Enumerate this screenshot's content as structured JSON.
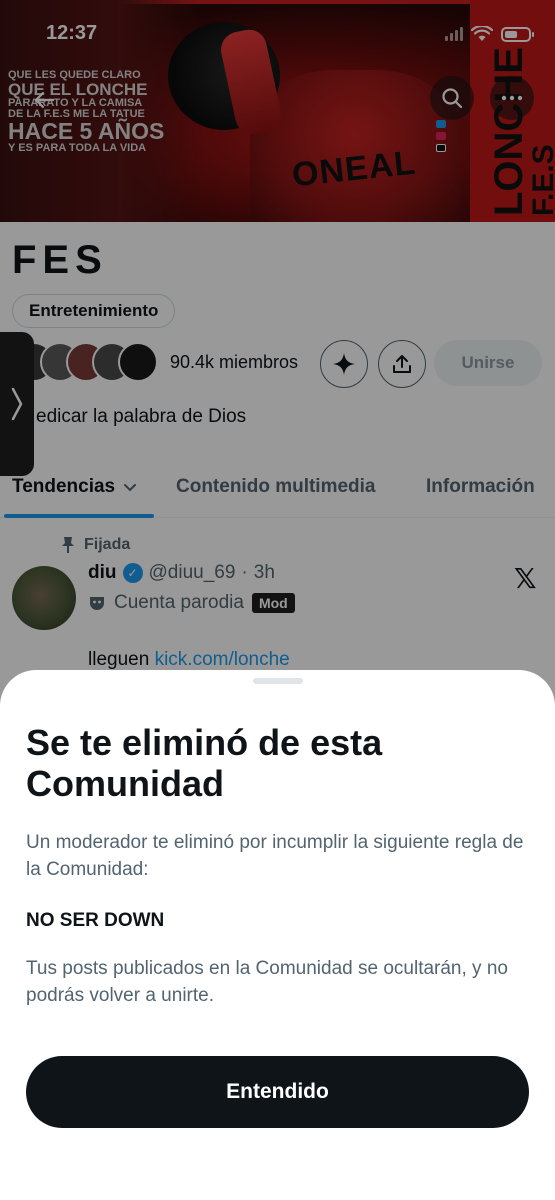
{
  "status_bar": {
    "time": "12:37"
  },
  "banner": {
    "quote_lines": [
      "QUE LES QUEDE CLARO",
      "QUE EL LONCHE",
      "PARARATO Y LA CAMISA",
      "DE LA F.E.S ME LA TATUE",
      "HACE 5 AÑOS",
      "Y ES PARA TODA LA VIDA"
    ],
    "brand": "ONEAL",
    "vertical_big": "LONCHE",
    "vertical_small": "F.E.S"
  },
  "community": {
    "name": "FES",
    "category": "Entretenimiento",
    "members": "90.4k miembros",
    "join_label": "Unirse",
    "description": "edicar la palabra de Dios"
  },
  "tabs": [
    {
      "label": "Tendencias",
      "active": true
    },
    {
      "label": "Contenido multimedia",
      "active": false
    },
    {
      "label": "Información",
      "active": false
    }
  ],
  "post": {
    "pinned_label": "Fijada",
    "name": "diu",
    "handle": "@diuu_69",
    "time": "3h",
    "parody_label": "Cuenta parodia",
    "mod_badge": "Mod",
    "text_prefix": "lleguen ",
    "link": "kick.com/lonche"
  },
  "sheet": {
    "title": "Se te eliminó de esta Comunidad",
    "description": "Un moderador te eliminó por incumplir la siguiente regla de la Comunidad:",
    "rule": "NO SER DOWN",
    "note": "Tus posts publicados en la Comunidad se ocultarán, y no podrás volver a unirte.",
    "button_label": "Entendido"
  },
  "colors": {
    "accent": "#1d9bf0",
    "dark": "#0f1419",
    "muted": "#536471"
  }
}
